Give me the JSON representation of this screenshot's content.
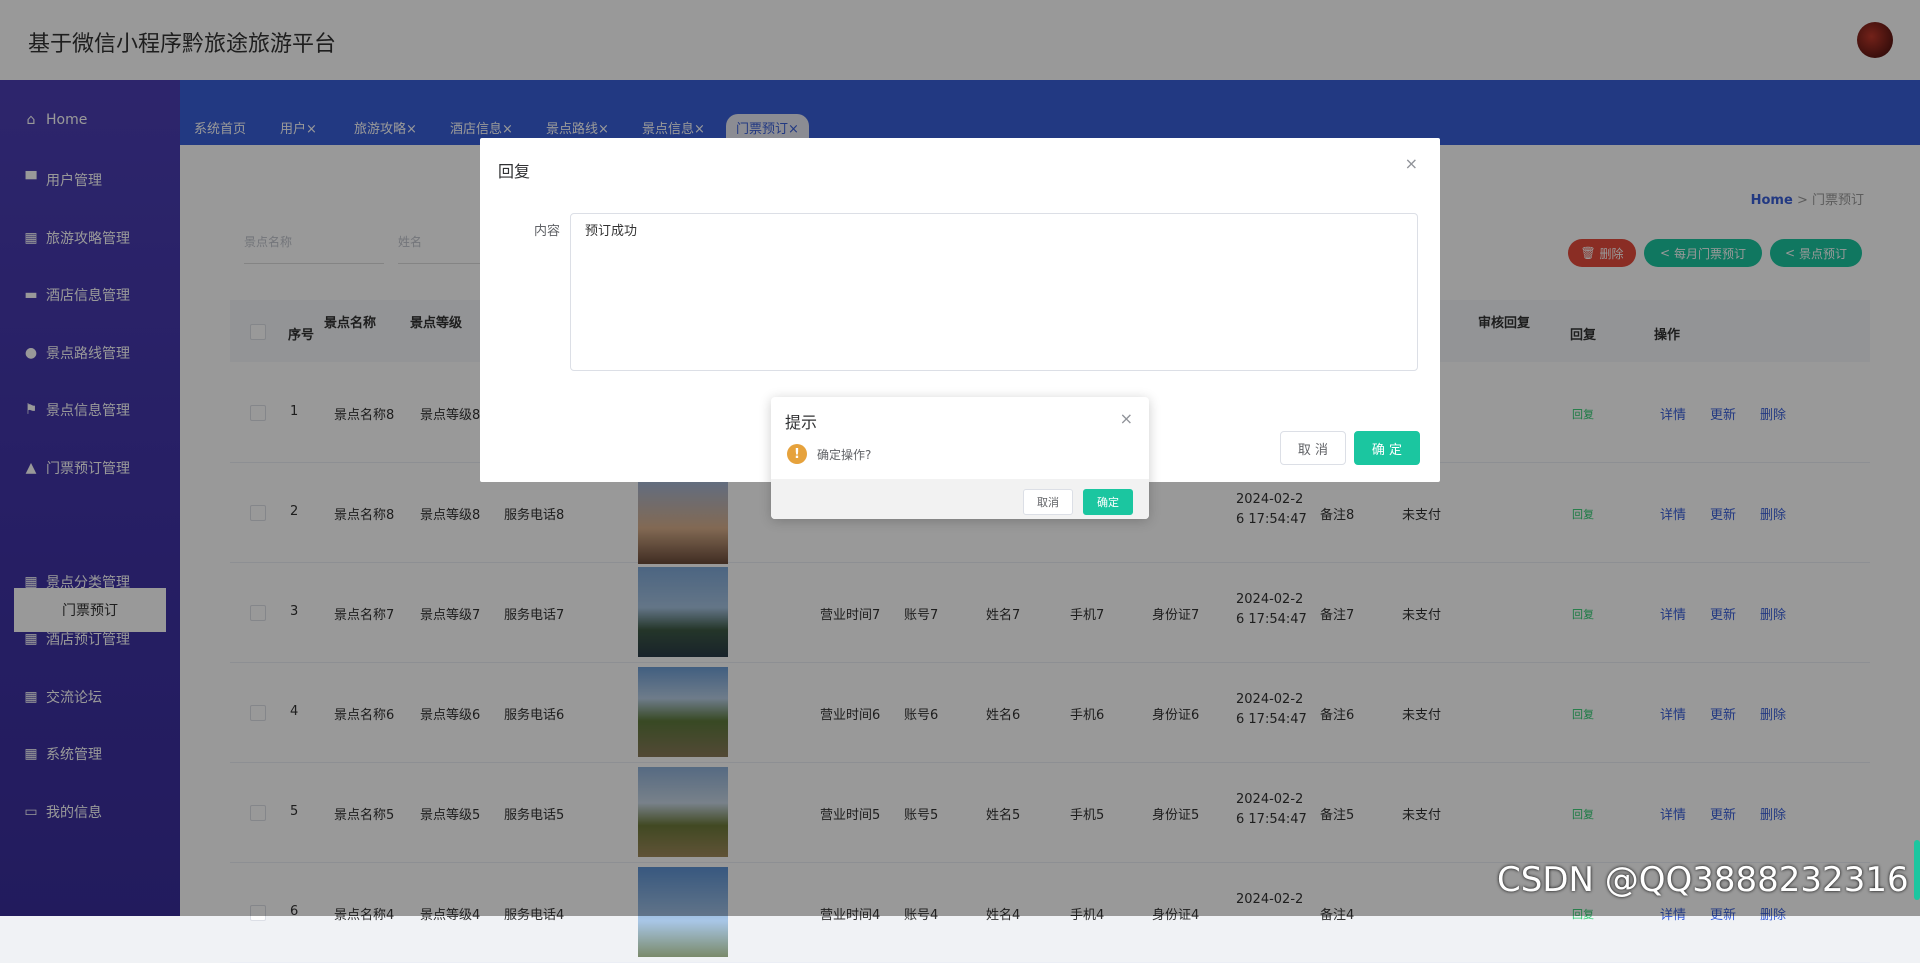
{
  "app": {
    "title": "基于微信小程序黔旅途旅游平台"
  },
  "sidebar": {
    "items": [
      {
        "label": "Home",
        "icon": "home-icon"
      },
      {
        "label": "用户管理",
        "icon": "user-icon"
      },
      {
        "label": "旅游攻略管理",
        "icon": "grid-icon"
      },
      {
        "label": "酒店信息管理",
        "icon": "briefcase-icon"
      },
      {
        "label": "景点路线管理",
        "icon": "map-pin-icon"
      },
      {
        "label": "景点信息管理",
        "icon": "flag-icon"
      },
      {
        "label": "门票预订管理",
        "icon": "person-icon"
      },
      {
        "label": "景点分类管理",
        "icon": "grid-icon"
      },
      {
        "label": "酒店预订管理",
        "icon": "grid-icon"
      },
      {
        "label": "交流论坛",
        "icon": "grid-icon"
      },
      {
        "label": "系统管理",
        "icon": "grid-icon"
      },
      {
        "label": "我的信息",
        "icon": "card-icon"
      }
    ],
    "sub_item": "门票预订"
  },
  "tabs": [
    {
      "label": "系统首页"
    },
    {
      "label": "用户×"
    },
    {
      "label": "旅游攻略×"
    },
    {
      "label": "酒店信息×"
    },
    {
      "label": "景点路线×"
    },
    {
      "label": "景点信息×"
    },
    {
      "label": "门票预订×"
    }
  ],
  "breadcrumb": {
    "home": "Home",
    "sep": ">",
    "current": "门票预订"
  },
  "search": {
    "scenic_placeholder": "景点名称",
    "name_placeholder": "姓名"
  },
  "actions": {
    "delete": "删除",
    "monthly": "每月门票预订",
    "scenic_order": "景点预订"
  },
  "table": {
    "headers": {
      "index": "序号",
      "scenic_name": "景点名称",
      "scenic_level": "景点等级",
      "audit_reply": "审核回复",
      "reply": "回复",
      "ops": "操作"
    },
    "rows": [
      {
        "index": "1",
        "name": "景点名称8",
        "level": "景点等级8",
        "phone": "",
        "hours": "",
        "account": "",
        "person": "",
        "mobile": "",
        "id_card": "",
        "date1": "",
        "date2": "",
        "note": "",
        "status": "",
        "reply": "回复",
        "detail": "详情",
        "update": "更新",
        "delete": "删除"
      },
      {
        "index": "2",
        "name": "景点名称8",
        "level": "景点等级8",
        "phone": "服务电话8",
        "hours": "",
        "account": "",
        "person": "",
        "mobile": "",
        "id_card": "",
        "date1": "2024-02-2",
        "date2": "6 17:54:47",
        "note": "备注8",
        "status": "未支付",
        "reply": "回复",
        "detail": "详情",
        "update": "更新",
        "delete": "删除"
      },
      {
        "index": "3",
        "name": "景点名称7",
        "level": "景点等级7",
        "phone": "服务电话7",
        "hours": "营业时间7",
        "account": "账号7",
        "person": "姓名7",
        "mobile": "手机7",
        "id_card": "身份证7",
        "date1": "2024-02-2",
        "date2": "6 17:54:47",
        "note": "备注7",
        "status": "未支付",
        "reply": "回复",
        "detail": "详情",
        "update": "更新",
        "delete": "删除"
      },
      {
        "index": "4",
        "name": "景点名称6",
        "level": "景点等级6",
        "phone": "服务电话6",
        "hours": "营业时间6",
        "account": "账号6",
        "person": "姓名6",
        "mobile": "手机6",
        "id_card": "身份证6",
        "date1": "2024-02-2",
        "date2": "6 17:54:47",
        "note": "备注6",
        "status": "未支付",
        "reply": "回复",
        "detail": "详情",
        "update": "更新",
        "delete": "删除"
      },
      {
        "index": "5",
        "name": "景点名称5",
        "level": "景点等级5",
        "phone": "服务电话5",
        "hours": "营业时间5",
        "account": "账号5",
        "person": "姓名5",
        "mobile": "手机5",
        "id_card": "身份证5",
        "date1": "2024-02-2",
        "date2": "6 17:54:47",
        "note": "备注5",
        "status": "未支付",
        "reply": "回复",
        "detail": "详情",
        "update": "更新",
        "delete": "删除"
      },
      {
        "index": "6",
        "name": "景点名称4",
        "level": "景点等级4",
        "phone": "服务电话4",
        "hours": "营业时间4",
        "account": "账号4",
        "person": "姓名4",
        "mobile": "手机4",
        "id_card": "身份证4",
        "date1": "2024-02-2",
        "date2": "",
        "note": "备注4",
        "status": "",
        "reply": "回复",
        "detail": "详情",
        "update": "更新",
        "delete": "删除"
      }
    ]
  },
  "reply_dialog": {
    "title": "回复",
    "close": "×",
    "label": "内容",
    "content": "预订成功",
    "cancel": "取 消",
    "confirm": "确 定"
  },
  "confirm_box": {
    "title": "提示",
    "close": "×",
    "icon": "!",
    "message": "确定操作?",
    "cancel": "取消",
    "confirm": "确定"
  },
  "watermark": "CSDN @QQ3888232316",
  "colors": {
    "primary": "#3a5fd9",
    "sidebar": "#4134a8",
    "accent": "#1bc6a0",
    "danger": "#e74c3c",
    "warning": "#e6a23c"
  }
}
